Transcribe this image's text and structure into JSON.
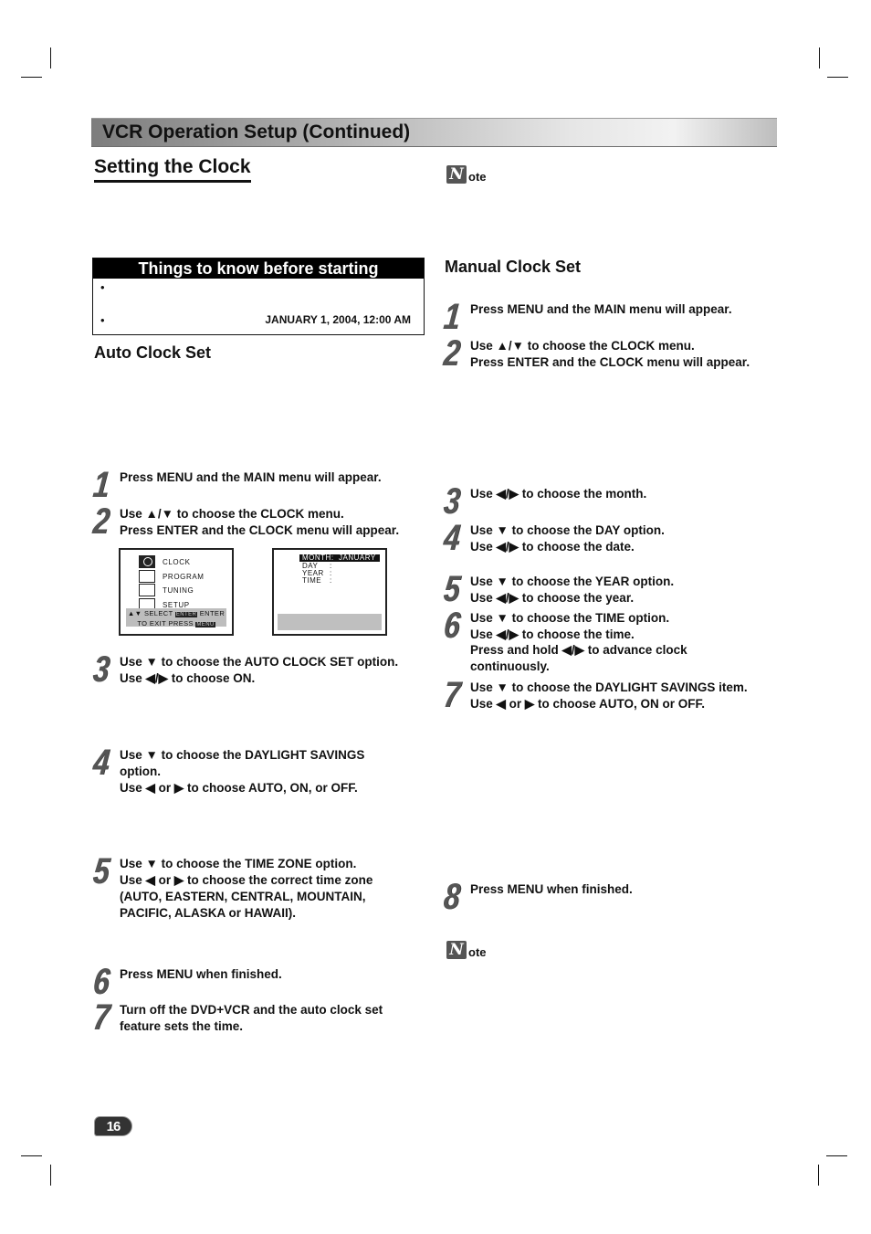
{
  "page": {
    "banner_title": "VCR Operation Setup (Continued)",
    "section_title": "Setting the Clock",
    "page_number": "16",
    "note_icon_letter": "N",
    "note_label": "ote"
  },
  "things_to_know": {
    "title": "Things to know before starting",
    "bullets": [
      "•",
      "•"
    ],
    "default_date": "JANUARY 1, 2004, 12:00 AM"
  },
  "auto_clock": {
    "heading": "Auto Clock Set",
    "steps": [
      {
        "num": "1",
        "lines": [
          "Press MENU and the MAIN menu will appear."
        ]
      },
      {
        "num": "2",
        "lines": [
          "Use ▲/▼ to choose the CLOCK menu.",
          "Press ENTER and the CLOCK menu will appear."
        ]
      },
      {
        "num": "3",
        "lines": [
          "Use ▼ to choose the AUTO CLOCK SET option.",
          "Use ◀/▶ to choose ON."
        ]
      },
      {
        "num": "4",
        "lines": [
          "Use ▼ to choose the DAYLIGHT SAVINGS",
          "option.",
          "Use ◀ or ▶ to choose AUTO, ON, or OFF."
        ]
      },
      {
        "num": "5",
        "lines": [
          "Use ▼ to choose the TIME ZONE option.",
          "Use ◀ or ▶ to choose the correct time zone",
          "(AUTO, EASTERN, CENTRAL, MOUNTAIN,",
          "PACIFIC, ALASKA or HAWAII)."
        ]
      },
      {
        "num": "6",
        "lines": [
          "Press MENU when finished."
        ]
      },
      {
        "num": "7",
        "lines": [
          "Turn off the DVD+VCR and the auto clock set",
          "feature sets the time."
        ]
      }
    ]
  },
  "manual_clock": {
    "heading": "Manual Clock Set",
    "steps": [
      {
        "num": "1",
        "lines": [
          "Press MENU and the MAIN menu will appear."
        ]
      },
      {
        "num": "2",
        "lines": [
          "Use ▲/▼ to choose the CLOCK menu.",
          "Press ENTER and the CLOCK menu will appear."
        ]
      },
      {
        "num": "3",
        "lines": [
          "Use ◀/▶ to choose the month."
        ]
      },
      {
        "num": "4",
        "lines": [
          "Use ▼ to choose the DAY option.",
          "Use ◀/▶ to choose the date."
        ]
      },
      {
        "num": "5",
        "lines": [
          "Use ▼ to choose the YEAR option.",
          "Use ◀/▶ to choose the year."
        ]
      },
      {
        "num": "6",
        "lines": [
          "Use ▼ to choose the TIME option.",
          "Use ◀/▶ to choose the time.",
          "Press and hold ◀/▶ to advance clock",
          "continuously."
        ]
      },
      {
        "num": "7",
        "lines": [
          "Use ▼ to choose the DAYLIGHT SAVINGS item.",
          "Use ◀ or ▶ to choose AUTO, ON or OFF."
        ]
      },
      {
        "num": "8",
        "lines": [
          "Press MENU when finished."
        ]
      }
    ]
  },
  "main_menu_screen": {
    "items": [
      {
        "icon": "clock-icon",
        "label": "CLOCK"
      },
      {
        "icon": "rec-program-icon",
        "label": "PROGRAM"
      },
      {
        "icon": "antenna-tuning-icon",
        "label": "TUNING"
      },
      {
        "icon": "setup-icon",
        "label": "SETUP"
      }
    ],
    "help_line1_a": "▲▼ SELECT",
    "help_enter_tag": "ENTER",
    "help_line1_b": "ENTER",
    "help_line2_a": "TO  EXIT PRESS",
    "help_menu_tag": "MENU"
  },
  "clock_menu_screen": {
    "rows": [
      {
        "label": "MONTH",
        "sep": ":",
        "value": "JANUARY"
      },
      {
        "label": "DAY",
        "sep": ":",
        "value": ""
      },
      {
        "label": "YEAR",
        "sep": ":",
        "value": ""
      },
      {
        "label": "TIME",
        "sep": ":",
        "value": ""
      }
    ]
  }
}
